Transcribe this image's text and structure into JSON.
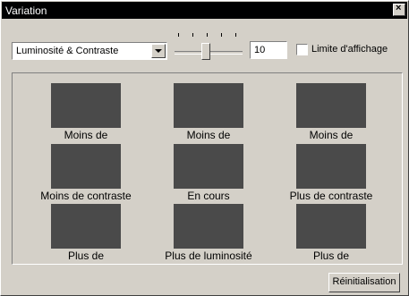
{
  "window": {
    "title": "Variation"
  },
  "toolbar": {
    "mode_select": "Luminosité & Contraste",
    "slider_value": "10",
    "display_limit_label": "Limite d'affichage",
    "display_limit_checked": false
  },
  "variants": [
    {
      "label": "Moins de"
    },
    {
      "label": "Moins de"
    },
    {
      "label": "Moins de"
    },
    {
      "label": "Moins de contraste"
    },
    {
      "label": "En cours"
    },
    {
      "label": "Plus de contraste"
    },
    {
      "label": "Plus de"
    },
    {
      "label": "Plus de luminosité"
    },
    {
      "label": "Plus de"
    }
  ],
  "footer": {
    "reset_label": "Réinitialisation"
  },
  "colors": {
    "swatch": "#4a4a4a",
    "titlebar": "#000000",
    "face": "#d4d0c8"
  }
}
